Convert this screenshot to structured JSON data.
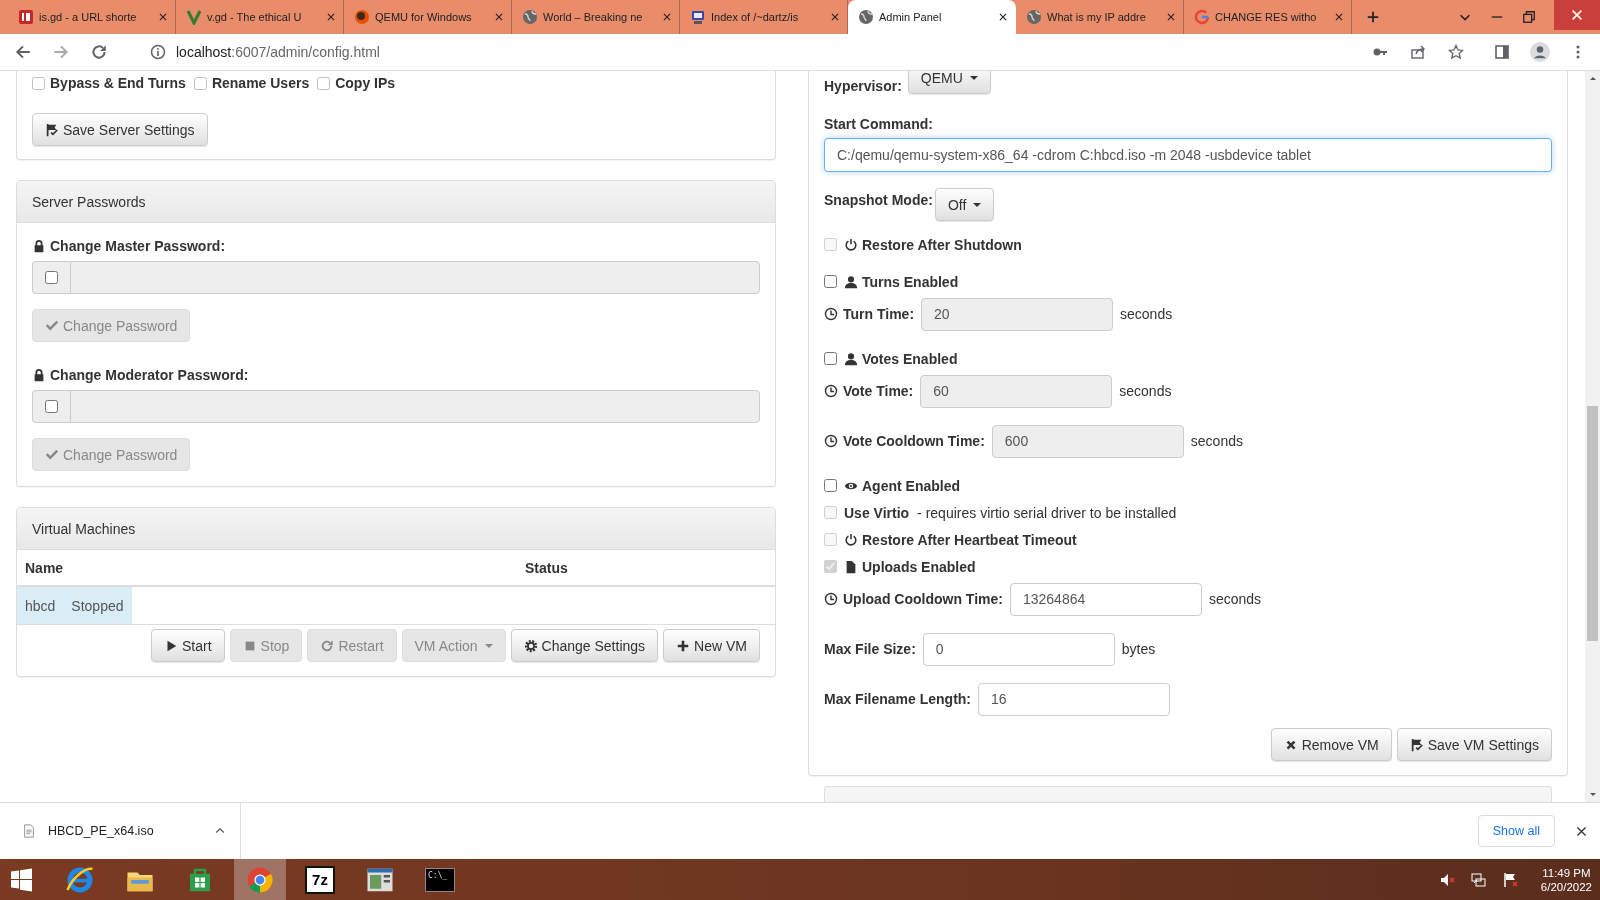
{
  "browser": {
    "tabs": [
      {
        "title": "is.gd - a URL shorte",
        "kind": "square",
        "selected": false
      },
      {
        "title": "v.gd - The ethical U",
        "kind": "vee",
        "selected": false
      },
      {
        "title": "QEMU for Windows",
        "kind": "ball",
        "selected": false
      },
      {
        "title": "World – Breaking ne",
        "kind": "globe",
        "selected": false
      },
      {
        "title": "Index of /~dartz/is",
        "kind": "computer",
        "selected": false
      },
      {
        "title": "Admin Panel",
        "kind": "globe",
        "selected": true
      },
      {
        "title": "What is my IP addre",
        "kind": "globe",
        "selected": false
      },
      {
        "title": "CHANGE RES witho",
        "kind": "ring",
        "selected": false
      }
    ],
    "address": {
      "host": "localhost",
      "path": ":6007/admin/config.html"
    }
  },
  "server_settings": {
    "permissions": [
      {
        "label": "Bypass & End Turns",
        "checked": false
      },
      {
        "label": "Rename Users",
        "checked": false
      },
      {
        "label": "Copy IPs",
        "checked": false
      }
    ],
    "save_button": "Save Server Settings"
  },
  "passwords_panel": {
    "title": "Server Passwords",
    "fields": [
      {
        "label": "Change Master Password:",
        "checked": false,
        "button": "Change Password",
        "disabled": true
      },
      {
        "label": "Change Moderator Password:",
        "checked": false,
        "button": "Change Password",
        "disabled": true
      }
    ]
  },
  "vm_panel": {
    "title": "Virtual Machines",
    "columns": [
      "Name",
      "Status"
    ],
    "rows": [
      {
        "cells": [
          "hbcd",
          "Stopped"
        ],
        "selected": true
      }
    ],
    "buttons": [
      {
        "label": "Start",
        "kind": "start",
        "disabled": false
      },
      {
        "label": "Stop",
        "kind": "stop",
        "disabled": true
      },
      {
        "label": "Restart",
        "kind": "restart",
        "disabled": true
      },
      {
        "label": "VM Action",
        "kind": "menu",
        "disabled": true
      },
      {
        "label": "Change Settings",
        "kind": "settings",
        "disabled": false
      },
      {
        "label": "New VM",
        "kind": "add",
        "disabled": false
      }
    ]
  },
  "vm_settings": {
    "hypervisor": {
      "label": "Hypervisor:",
      "value": "QEMU"
    },
    "start_command": {
      "label": "Start Command:",
      "value": "C:/qemu/qemu-system-x86_64 -cdrom C:hbcd.iso -m 2048 -usbdevice tablet"
    },
    "snapshot": {
      "label": "Snapshot Mode:",
      "value": "Off"
    },
    "groups": [
      [
        {
          "kind": "restore",
          "label": "Restore After Shutdown",
          "checked": false,
          "disabled": true
        }
      ],
      [
        {
          "kind": "toggle",
          "label": "Turns Enabled",
          "checked": false,
          "disabled": false
        },
        {
          "kind": "timer",
          "label": "Turn Time:",
          "value": "20",
          "unit": "seconds",
          "disabled": true
        }
      ],
      [
        {
          "kind": "toggle",
          "label": "Votes Enabled",
          "checked": false,
          "disabled": false
        },
        {
          "kind": "timer",
          "label": "Vote Time:",
          "value": "60",
          "unit": "seconds",
          "disabled": true
        }
      ],
      [
        {
          "kind": "timer",
          "label": "Vote Cooldown Time:",
          "value": "600",
          "unit": "seconds",
          "disabled": true
        }
      ],
      [
        {
          "kind": "agent",
          "label": "Agent Enabled",
          "checked": false,
          "disabled": false
        },
        {
          "kind": "option",
          "label": "Use Virtio",
          "note": "- requires virtio serial driver to be installed",
          "checked": false,
          "disabled": true
        },
        {
          "kind": "restore",
          "label": "Restore After Heartbeat Timeout",
          "checked": false,
          "disabled": true
        },
        {
          "kind": "upload",
          "label": "Uploads Enabled",
          "checked": true,
          "disabled": true
        },
        {
          "kind": "timer",
          "label": "Upload Cooldown Time:",
          "value": "13264864",
          "unit": "seconds",
          "disabled": false
        }
      ],
      [
        {
          "kind": "number",
          "label": "Max File Size:",
          "value": "0",
          "unit": "bytes",
          "disabled": false
        }
      ],
      [
        {
          "kind": "number",
          "label": "Max Filename Length:",
          "value": "16",
          "disabled": false
        }
      ]
    ],
    "buttons": [
      {
        "label": "Remove VM",
        "kind": "remove"
      },
      {
        "label": "Save VM Settings",
        "kind": "save"
      }
    ]
  },
  "downloads": {
    "file": "HBCD_PE_x64.iso",
    "show_all": "Show all"
  },
  "taskbar": {
    "apps": [
      {
        "kind": "ie",
        "selected": false
      },
      {
        "kind": "folder",
        "selected": false
      },
      {
        "kind": "store",
        "selected": false
      },
      {
        "kind": "chrome",
        "selected": true
      },
      {
        "kind": "archiver",
        "label": "7z",
        "selected": false
      },
      {
        "kind": "window",
        "selected": false
      },
      {
        "kind": "terminal",
        "label": "C:\\_",
        "selected": false
      }
    ],
    "time": "11:49 PM",
    "date": "6/20/2022"
  }
}
